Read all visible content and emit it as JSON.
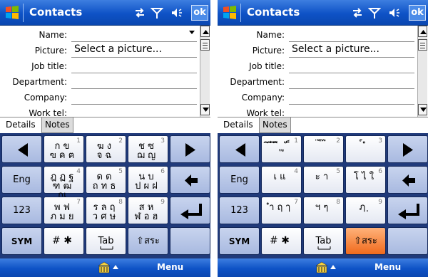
{
  "screens": [
    {
      "id": "left",
      "title": "Contacts",
      "ok_label": "ok",
      "fields": [
        {
          "label": "Name:",
          "value": ""
        },
        {
          "label": "Picture:",
          "value": "Select a picture..."
        },
        {
          "label": "Job title:",
          "value": ""
        },
        {
          "label": "Department:",
          "value": ""
        },
        {
          "label": "Company:",
          "value": ""
        },
        {
          "label": "Work tel:",
          "value": ""
        }
      ],
      "tabs": [
        "Details",
        "Notes"
      ],
      "keyboard": {
        "fn_keys": {
          "eng": "Eng",
          "num": "123",
          "sym": "SYM",
          "tab": "Tab",
          "shift": "⇧สระ"
        },
        "char_keys": [
          {
            "chars": "ก ข\nฃ ค ฅ",
            "num": "1"
          },
          {
            "chars": "ฆ ง\nจ ฉ",
            "num": "2"
          },
          {
            "chars": "ช ซ\nฌ ญ",
            "num": "3"
          },
          {
            "chars": "ฎ ฏ ฐ\nฑ ฒ ณ",
            "num": "4"
          },
          {
            "chars": "ด ต\nถ ท ธ",
            "num": "5"
          },
          {
            "chars": "น บ\nป ผ ฝ",
            "num": "6"
          },
          {
            "chars": "พ ฟ\nภ ม ย",
            "num": "7"
          },
          {
            "chars": "ร ล ฤ\nว ศ ษ",
            "num": "8"
          },
          {
            "chars": "ส ห\nฬ อ ฮ",
            "num": "9"
          },
          {
            "chars": "# ✱",
            "num": ""
          }
        ]
      },
      "menu_label": "Menu",
      "shift_active": false
    },
    {
      "id": "right",
      "title": "Contacts",
      "ok_label": "ok",
      "fields": [
        {
          "label": "Name:",
          "value": ""
        },
        {
          "label": "Picture:",
          "value": "Select a picture..."
        },
        {
          "label": "Job title:",
          "value": ""
        },
        {
          "label": "Department:",
          "value": ""
        },
        {
          "label": "Company:",
          "value": ""
        },
        {
          "label": "Work tel:",
          "value": ""
        }
      ],
      "tabs": [
        "Details",
        "Notes"
      ],
      "keyboard": {
        "fn_keys": {
          "eng": "Eng",
          "num": "123",
          "sym": "SYM",
          "tab": "Tab",
          "shift": "⇧สระ"
        },
        "char_keys": [
          {
            "chars": "ิ ี ึ ื ุ ู ั ็",
            "num": "1"
          },
          {
            "chars": "่ ้ ๊ ๋",
            "num": "2"
          },
          {
            "chars": "์ ํ",
            "num": "3"
          },
          {
            "chars": "เ แ",
            "num": "4"
          },
          {
            "chars": "ะ า",
            "num": "5"
          },
          {
            "chars": "โ ไ ใ",
            "num": "6"
          },
          {
            "chars": "ำ ฤ ๅ",
            "num": "7"
          },
          {
            "chars": "ฯ ๆ",
            "num": "8"
          },
          {
            "chars": "ฦ ฺ",
            "num": "9"
          },
          {
            "chars": "# ✱",
            "num": ""
          }
        ]
      },
      "menu_label": "Menu",
      "shift_active": true
    }
  ],
  "colors": {
    "titlebar": "#0e52c6",
    "keyboard_bg": "#203a7a",
    "function_key": "#b8c6e8",
    "char_key": "#f4f6fa",
    "active_key": "#f06a1c"
  }
}
